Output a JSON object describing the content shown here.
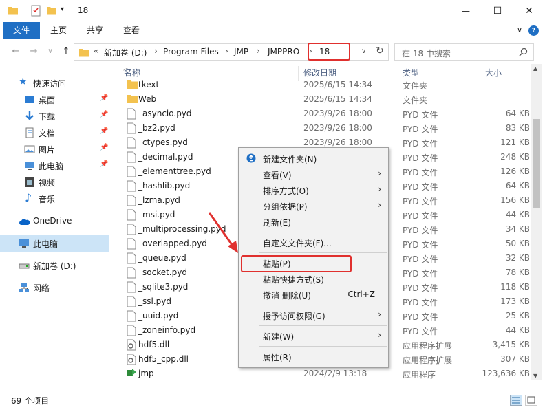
{
  "window": {
    "title": "18",
    "minimize_glyph": "—",
    "maximize_glyph": "☐",
    "close_glyph": "✕"
  },
  "ribbon": {
    "tabs": [
      "文件",
      "主页",
      "共享",
      "查看"
    ],
    "expand_glyph": "∨",
    "help_glyph": "?"
  },
  "address": {
    "back_glyph": "←",
    "forward_glyph": "→",
    "recent_glyph": "∨",
    "up_glyph": "↑",
    "overflow": "«",
    "crumbs": [
      "新加卷 (D:)",
      "Program Files",
      "JMP",
      "JMPPRO",
      "18"
    ],
    "dropdown_glyph": "∨",
    "refresh_glyph": "↻",
    "search_placeholder": "在 18 中搜索",
    "highlight_color": "#e0302e"
  },
  "sidebar": {
    "items": [
      {
        "label": "快速访问",
        "icon": "star-icon"
      },
      {
        "label": "桌面",
        "icon": "desktop-icon",
        "pinned": true
      },
      {
        "label": "下载",
        "icon": "download-icon",
        "pinned": true
      },
      {
        "label": "文档",
        "icon": "document-icon",
        "pinned": true
      },
      {
        "label": "图片",
        "icon": "picture-icon",
        "pinned": true
      },
      {
        "label": "此电脑",
        "icon": "computer-icon",
        "pinned": true
      },
      {
        "label": "视频",
        "icon": "video-icon"
      },
      {
        "label": "音乐",
        "icon": "music-icon"
      },
      {
        "label": "OneDrive",
        "icon": "cloud-icon"
      },
      {
        "label": "此电脑",
        "icon": "computer-icon",
        "selected": true
      },
      {
        "label": "新加卷 (D:)",
        "icon": "drive-icon"
      },
      {
        "label": "网络",
        "icon": "network-icon"
      }
    ]
  },
  "columns": {
    "name": "名称",
    "date": "修改日期",
    "type": "类型",
    "size": "大小"
  },
  "files": [
    {
      "name": "tkext",
      "date": "2025/6/15 14:34",
      "type": "文件夹",
      "size": "",
      "kind": "folder"
    },
    {
      "name": "Web",
      "date": "2025/6/15 14:34",
      "type": "文件夹",
      "size": "",
      "kind": "folder"
    },
    {
      "name": "_asyncio.pyd",
      "date": "2023/9/26 18:00",
      "type": "PYD 文件",
      "size": "64 KB",
      "kind": "file"
    },
    {
      "name": "_bz2.pyd",
      "date": "2023/9/26 18:00",
      "type": "PYD 文件",
      "size": "83 KB",
      "kind": "file"
    },
    {
      "name": "_ctypes.pyd",
      "date": "2023/9/26 18:00",
      "type": "PYD 文件",
      "size": "121 KB",
      "kind": "file"
    },
    {
      "name": "_decimal.pyd",
      "date": "",
      "type": "PYD 文件",
      "size": "248 KB",
      "kind": "file"
    },
    {
      "name": "_elementtree.pyd",
      "date": "",
      "type": "PYD 文件",
      "size": "126 KB",
      "kind": "file"
    },
    {
      "name": "_hashlib.pyd",
      "date": "",
      "type": "PYD 文件",
      "size": "64 KB",
      "kind": "file"
    },
    {
      "name": "_lzma.pyd",
      "date": "",
      "type": "PYD 文件",
      "size": "156 KB",
      "kind": "file"
    },
    {
      "name": "_msi.pyd",
      "date": "",
      "type": "PYD 文件",
      "size": "44 KB",
      "kind": "file"
    },
    {
      "name": "_multiprocessing.pyd",
      "date": "",
      "type": "PYD 文件",
      "size": "34 KB",
      "kind": "file"
    },
    {
      "name": "_overlapped.pyd",
      "date": "",
      "type": "PYD 文件",
      "size": "50 KB",
      "kind": "file"
    },
    {
      "name": "_queue.pyd",
      "date": "",
      "type": "PYD 文件",
      "size": "32 KB",
      "kind": "file"
    },
    {
      "name": "_socket.pyd",
      "date": "",
      "type": "PYD 文件",
      "size": "78 KB",
      "kind": "file"
    },
    {
      "name": "_sqlite3.pyd",
      "date": "",
      "type": "PYD 文件",
      "size": "118 KB",
      "kind": "file"
    },
    {
      "name": "_ssl.pyd",
      "date": "",
      "type": "PYD 文件",
      "size": "173 KB",
      "kind": "file"
    },
    {
      "name": "_uuid.pyd",
      "date": "",
      "type": "PYD 文件",
      "size": "25 KB",
      "kind": "file"
    },
    {
      "name": "_zoneinfo.pyd",
      "date": "",
      "type": "PYD 文件",
      "size": "44 KB",
      "kind": "file"
    },
    {
      "name": "hdf5.dll",
      "date": "",
      "type": "应用程序扩展",
      "size": "3,415 KB",
      "kind": "dll"
    },
    {
      "name": "hdf5_cpp.dll",
      "date": "",
      "type": "应用程序扩展",
      "size": "307 KB",
      "kind": "dll"
    },
    {
      "name": "jmp",
      "date": "2024/2/9 13:18",
      "type": "应用程序",
      "size": "123,636 KB",
      "kind": "exe"
    }
  ],
  "context_menu": {
    "items": [
      {
        "label": "新建文件夹(N)",
        "icon": "new-folder-icon"
      },
      {
        "label": "查看(V)",
        "submenu": true
      },
      {
        "label": "排序方式(O)",
        "submenu": true
      },
      {
        "label": "分组依据(P)",
        "submenu": true
      },
      {
        "label": "刷新(E)"
      },
      {
        "separator": true
      },
      {
        "label": "自定义文件夹(F)..."
      },
      {
        "separator": true
      },
      {
        "label": "粘贴(P)",
        "highlighted": true
      },
      {
        "label": "粘贴快捷方式(S)"
      },
      {
        "label": "撤消 删除(U)",
        "shortcut": "Ctrl+Z"
      },
      {
        "separator": true
      },
      {
        "label": "授予访问权限(G)",
        "submenu": true
      },
      {
        "separator": true
      },
      {
        "label": "新建(W)",
        "submenu": true
      },
      {
        "separator": true
      },
      {
        "label": "属性(R)"
      }
    ],
    "submenu_glyph": "›"
  },
  "status": {
    "count_text": "69 个项目"
  },
  "colors": {
    "accent": "#1f6fc4",
    "folder": "#f3c24f",
    "selection": "#cce4f7",
    "annotation": "#e0302e"
  }
}
